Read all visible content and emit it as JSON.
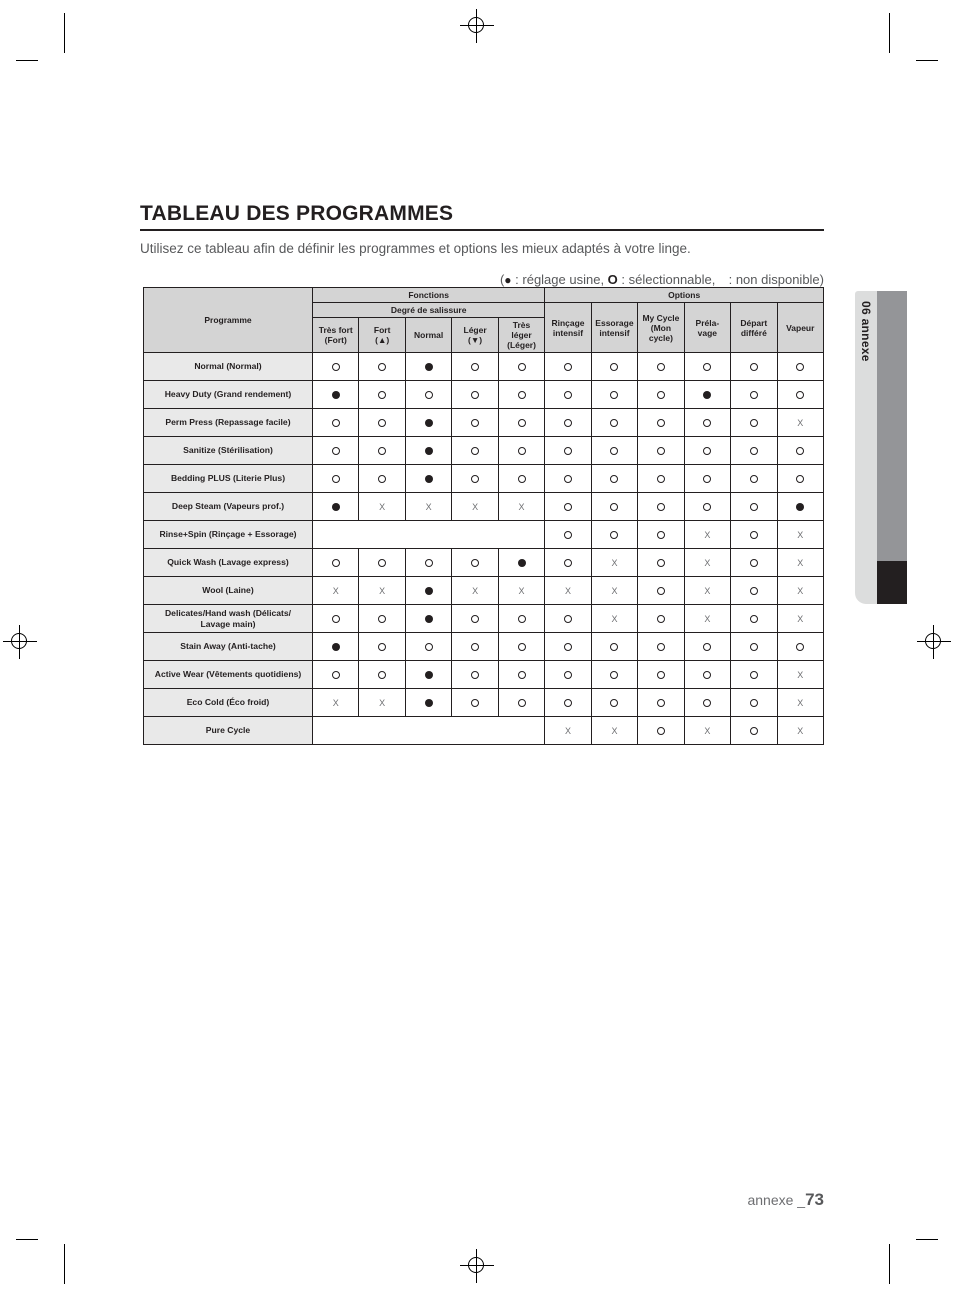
{
  "page": {
    "title": "TABLEAU DES PROGRAMMES",
    "intro": "Utilisez ce tableau afin de définir les programmes et options les mieux adaptés à votre linge.",
    "legend": {
      "open_paren": "(",
      "filled_label": " : réglage usine, ",
      "open_label": " : sélectionnable, ",
      "none_label": " : non disponible)"
    },
    "chapter_tab": "06 annexe",
    "footer_label": "annexe _",
    "footer_page": "73"
  },
  "table": {
    "group_headers": {
      "programme": "Programme",
      "fonctions": "Fonctions",
      "options": "Options",
      "degre": "Degré de salissure"
    },
    "soil_columns": [
      "Très fort\n(Fort)",
      "Fort\n(▲)",
      "Normal",
      "Léger\n(▼)",
      "Très\nléger\n(Léger)"
    ],
    "option_columns": [
      "Rinçage\nintensif",
      "Essorage\nintensif",
      "My Cycle\n(Mon\ncycle)",
      "Préla-\nvage",
      "Départ\ndifféré",
      "Vapeur"
    ],
    "rows": [
      {
        "label": "Normal (Normal)",
        "soil": [
          "O",
          "O",
          "F",
          "O",
          "O"
        ],
        "options": [
          "O",
          "O",
          "O",
          "O",
          "O",
          "O"
        ]
      },
      {
        "label": "Heavy Duty (Grand rendement)",
        "soil": [
          "F",
          "O",
          "O",
          "O",
          "O"
        ],
        "options": [
          "O",
          "O",
          "O",
          "F",
          "O",
          "O"
        ]
      },
      {
        "label": "Perm Press (Repassage facile)",
        "soil": [
          "O",
          "O",
          "F",
          "O",
          "O"
        ],
        "options": [
          "O",
          "O",
          "O",
          "O",
          "O",
          "X"
        ]
      },
      {
        "label": "Sanitize (Stérilisation)",
        "soil": [
          "O",
          "O",
          "F",
          "O",
          "O"
        ],
        "options": [
          "O",
          "O",
          "O",
          "O",
          "O",
          "O"
        ]
      },
      {
        "label": "Bedding PLUS (Literie Plus)",
        "soil": [
          "O",
          "O",
          "F",
          "O",
          "O"
        ],
        "options": [
          "O",
          "O",
          "O",
          "O",
          "O",
          "O"
        ]
      },
      {
        "label": "Deep Steam (Vapeurs prof.)",
        "soil": [
          "F",
          "X",
          "X",
          "X",
          "X"
        ],
        "options": [
          "O",
          "O",
          "O",
          "O",
          "O",
          "F"
        ]
      },
      {
        "label": "Rinse+Spin (Rinçage + Essorage)",
        "soil": null,
        "options": [
          "O",
          "O",
          "O",
          "X",
          "O",
          "X"
        ]
      },
      {
        "label": "Quick Wash (Lavage express)",
        "soil": [
          "O",
          "O",
          "O",
          "O",
          "F"
        ],
        "options": [
          "O",
          "X",
          "O",
          "X",
          "O",
          "X"
        ]
      },
      {
        "label": "Wool (Laine)",
        "soil": [
          "X",
          "X",
          "F",
          "X",
          "X"
        ],
        "options": [
          "X",
          "X",
          "O",
          "X",
          "O",
          "X"
        ]
      },
      {
        "label": "Delicates/Hand wash (Délicats/\nLavage main)",
        "soil": [
          "O",
          "O",
          "F",
          "O",
          "O"
        ],
        "options": [
          "O",
          "X",
          "O",
          "X",
          "O",
          "X"
        ]
      },
      {
        "label": "Stain Away (Anti-tache)",
        "soil": [
          "F",
          "O",
          "O",
          "O",
          "O"
        ],
        "options": [
          "O",
          "O",
          "O",
          "O",
          "O",
          "O"
        ]
      },
      {
        "label": "Active Wear (Vêtements quotidiens)",
        "soil": [
          "O",
          "O",
          "F",
          "O",
          "O"
        ],
        "options": [
          "O",
          "O",
          "O",
          "O",
          "O",
          "X"
        ]
      },
      {
        "label": "Eco Cold (Éco froid)",
        "soil": [
          "X",
          "X",
          "F",
          "O",
          "O"
        ],
        "options": [
          "O",
          "O",
          "O",
          "O",
          "O",
          "X"
        ]
      },
      {
        "label": "Pure Cycle",
        "soil": null,
        "options": [
          "X",
          "X",
          "O",
          "X",
          "O",
          "X"
        ]
      }
    ]
  }
}
